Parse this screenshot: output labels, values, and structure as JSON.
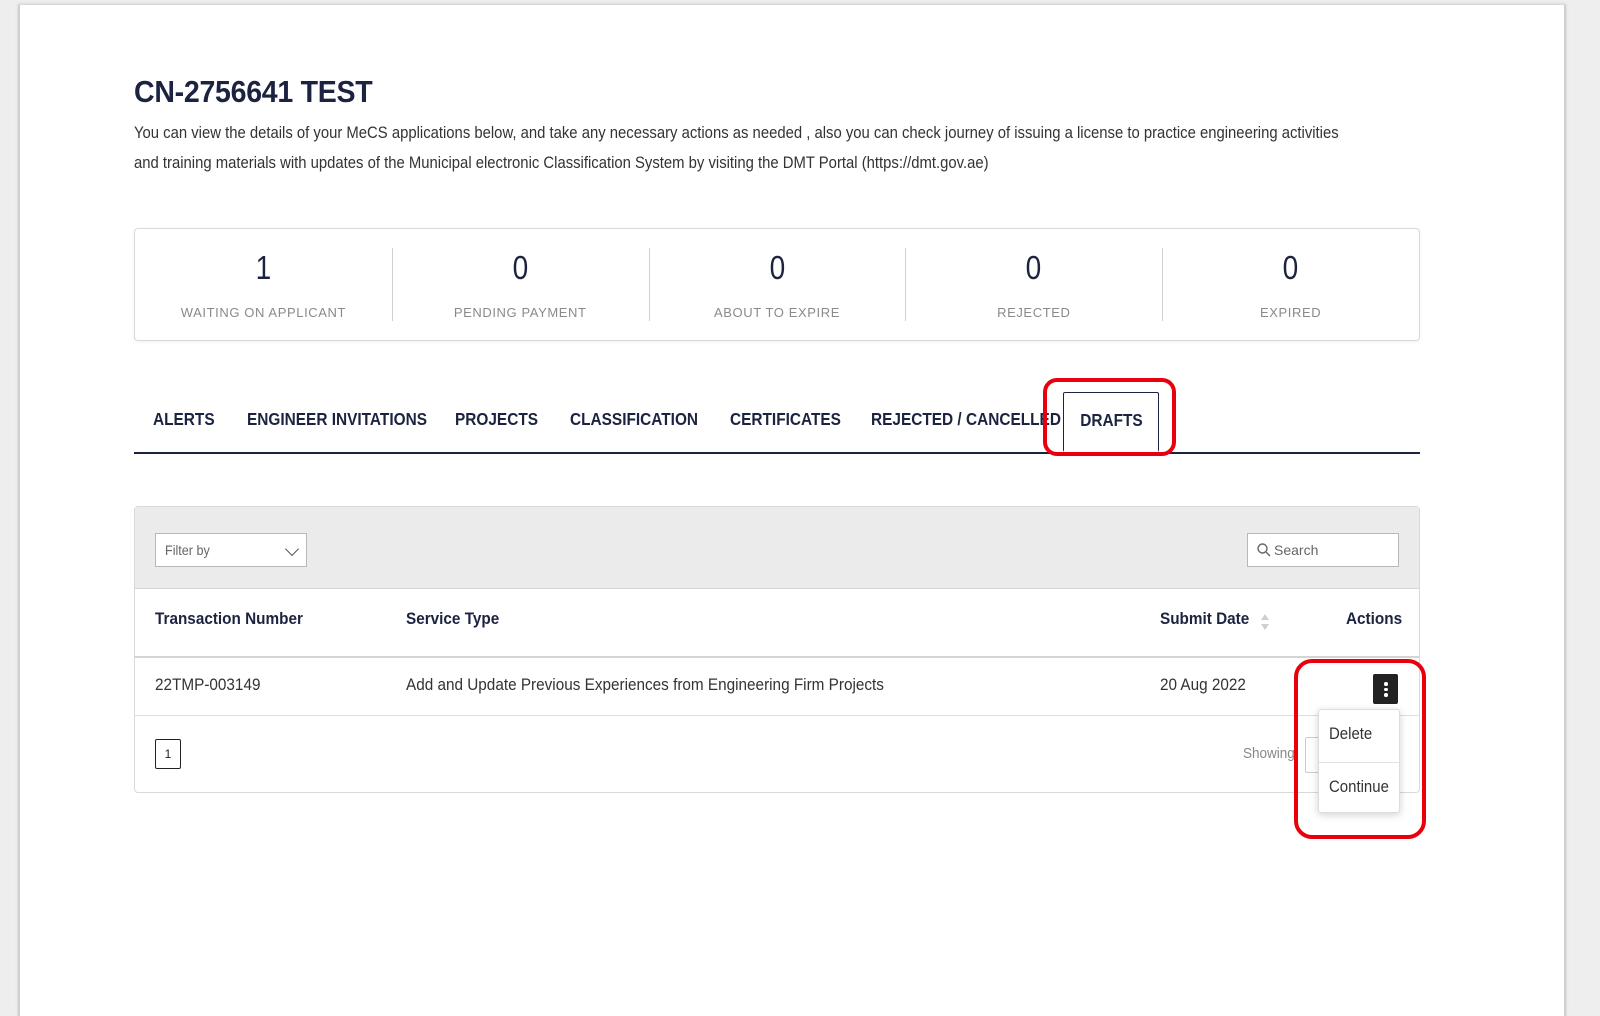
{
  "page": {
    "title": "CN-2756641 TEST",
    "description": "You can view the details of your MeCS applications below, and take any necessary actions as needed , also you can check journey of issuing a license to practice engineering activities and training materials with updates of the Municipal electronic Classification System by visiting the DMT Portal (https://dmt.gov.ae)"
  },
  "stats": [
    {
      "value": "1",
      "label": "WAITING ON APPLICANT"
    },
    {
      "value": "0",
      "label": "PENDING PAYMENT"
    },
    {
      "value": "0",
      "label": "ABOUT TO EXPIRE"
    },
    {
      "value": "0",
      "label": "REJECTED"
    },
    {
      "value": "0",
      "label": "EXPIRED"
    }
  ],
  "tabs": [
    {
      "label": "ALERTS"
    },
    {
      "label": "ENGINEER INVITATIONS"
    },
    {
      "label": "PROJECTS"
    },
    {
      "label": "CLASSIFICATION"
    },
    {
      "label": "CERTIFICATES"
    },
    {
      "label": "REJECTED / CANCELLED"
    },
    {
      "label": "DRAFTS",
      "active": true
    }
  ],
  "table": {
    "filter_placeholder": "Filter by",
    "search_placeholder": "Search",
    "columns": [
      "Transaction Number",
      "Service Type",
      "Submit Date",
      "Actions"
    ],
    "rows": [
      {
        "transaction_number": "22TMP-003149",
        "service_type": "Add and Update Previous Experiences from Engineering Firm Projects",
        "submit_date": "20 Aug 2022"
      }
    ],
    "pagination": {
      "current_page": "1",
      "showing_text": "Showing"
    }
  },
  "action_menu": {
    "items": [
      "Delete",
      "Continue"
    ]
  },
  "icons": {
    "search": "search-icon",
    "filter_dropdown": "chevron-down-icon",
    "sort": "sort-icon",
    "row_actions": "kebab-menu-icon"
  },
  "colors": {
    "primary_text": "#1c2340",
    "highlight": "#e8000d",
    "header_bg": "#ebebeb"
  }
}
